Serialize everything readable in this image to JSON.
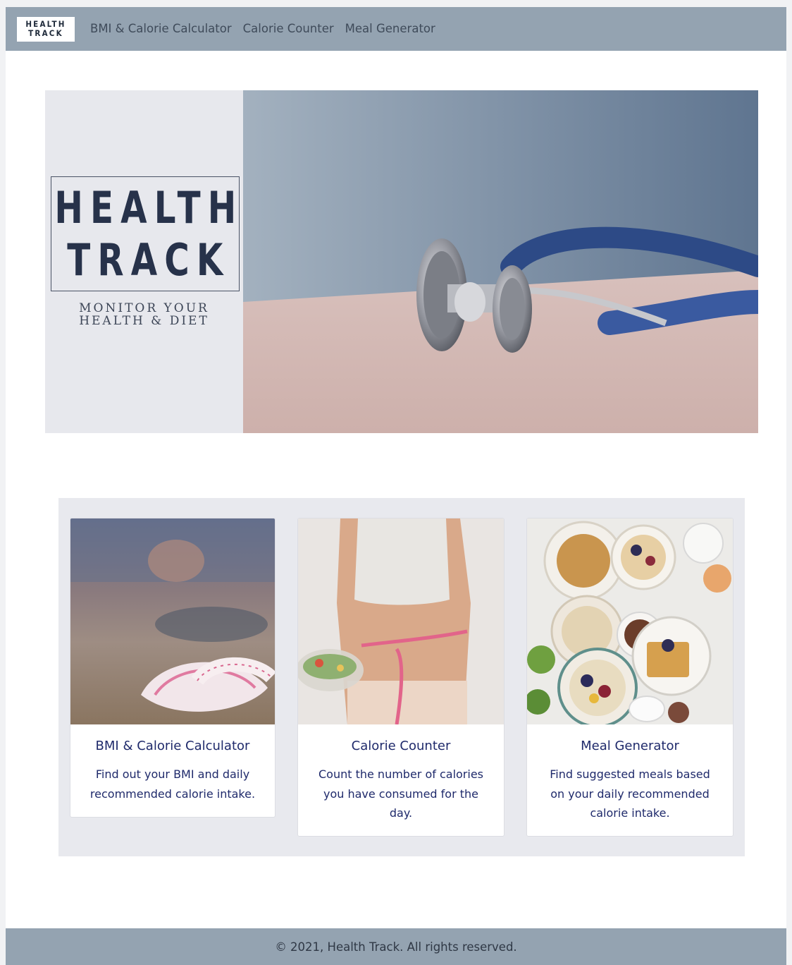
{
  "nav": {
    "logo_line1": "HEALTH",
    "logo_line2": "TRACK",
    "links": [
      "BMI & Calorie Calculator",
      "Calorie Counter",
      "Meal Generator"
    ]
  },
  "hero": {
    "brand_line1": "HEALTH",
    "brand_line2": "TRACK",
    "tagline_line1": "MONITOR YOUR",
    "tagline_line2": "HEALTH & DIET"
  },
  "cards": [
    {
      "title": "BMI & Calorie Calculator",
      "description": "Find out your BMI and daily recommended calorie intake."
    },
    {
      "title": "Calorie Counter",
      "description": "Count the number of calories you have consumed for the day."
    },
    {
      "title": "Meal Generator",
      "description": "Find suggested meals based on your daily recommended calorie intake."
    }
  ],
  "footer": {
    "text": "© 2021, Health Track. All rights reserved."
  },
  "colors": {
    "navbar": "#94a3b1",
    "brand_panel": "#e7e8ed",
    "brand_text": "#27324a",
    "card_text": "#1f2a6b",
    "features_bg": "#e8e9ee"
  }
}
